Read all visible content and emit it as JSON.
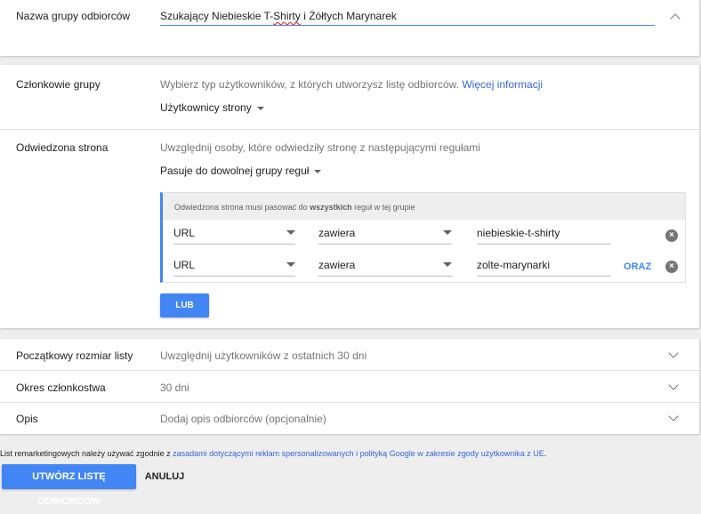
{
  "audience_name": {
    "label": "Nazwa grupy odbiorców",
    "value_before": "Szukający Niebieskie T-",
    "value_misspelled": "Shirty",
    "value_after": " i Żółtych Marynarek"
  },
  "members": {
    "label": "Członkowie grupy",
    "hint": "Wybierz typ użytkowników, z których utworzysz listę odbiorców.",
    "more_link": "Więcej informacji",
    "selected": "Użytkownicy strony"
  },
  "visited_page": {
    "label": "Odwiedzona strona",
    "hint": "Uwzględnij osoby, które odwiedziły stronę z następującymi regułami",
    "match_selected": "Pasuje do dowolnej grupy reguł",
    "rule_group": {
      "header_before": "Odwiedzona strona musi pasować do ",
      "header_bold": "wszystkich",
      "header_after": " reguł w tej grupie",
      "rules": [
        {
          "field": "URL",
          "operator": "zawiera",
          "value": "niebieskie-t-shirty"
        },
        {
          "field": "URL",
          "operator": "zawiera",
          "value": "zolte-marynarki"
        }
      ],
      "and_label": "ORAZ"
    },
    "or_label": "LUB"
  },
  "initial_size": {
    "label": "Początkowy rozmiar listy",
    "value": "Uwzględnij użytkowników z ostatnich 30 dni"
  },
  "membership": {
    "label": "Okres członkostwa",
    "value": "30 dni"
  },
  "description": {
    "label": "Opis",
    "placeholder": "Dodaj opis odbiorców (opcjonalnie)"
  },
  "footer": {
    "text_before": "List remarketingowych należy używać zgodnie z ",
    "policy_link": "zasadami dotyczącymi reklam spersonalizowanych i polityką Google w zakresie zgody użytkownika z UE",
    "text_after": ".",
    "create_label": "UTWÓRZ LISTĘ ODBIORCÓW",
    "cancel_label": "ANULUJ"
  },
  "colors": {
    "accent": "#4285f4",
    "link": "#3367d6",
    "background": "#eeeeee"
  }
}
